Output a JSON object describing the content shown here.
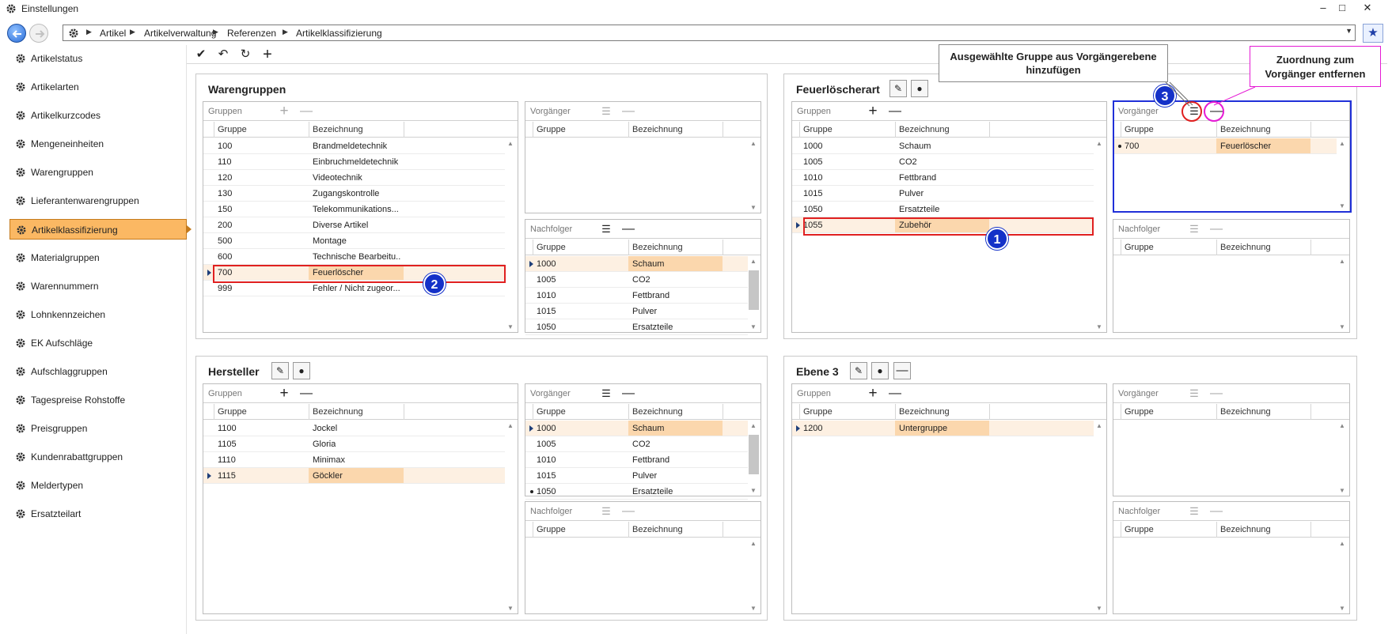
{
  "window": {
    "title": "Einstellungen",
    "minimize": "–",
    "maximize": "□",
    "close": "✕"
  },
  "nav": {
    "crumbs": [
      "Artikel",
      "Artikelverwaltung",
      "Referenzen",
      "Artikelklassifizierung"
    ],
    "star": "★"
  },
  "sidebar": {
    "items": [
      {
        "label": "Artikelstatus"
      },
      {
        "label": "Artikelarten"
      },
      {
        "label": "Artikelkurzcodes"
      },
      {
        "label": "Mengeneinheiten"
      },
      {
        "label": "Warengruppen"
      },
      {
        "label": "Lieferantenwarengruppen"
      },
      {
        "label": "Artikelklassifizierung",
        "active": true
      },
      {
        "label": "Materialgruppen"
      },
      {
        "label": "Warennummern"
      },
      {
        "label": "Lohnkennzeichen"
      },
      {
        "label": "EK Aufschläge"
      },
      {
        "label": "Aufschlaggruppen"
      },
      {
        "label": "Tagespreise Rohstoffe"
      },
      {
        "label": "Preisgruppen"
      },
      {
        "label": "Kundenrabattgruppen"
      },
      {
        "label": "Meldertypen"
      },
      {
        "label": "Ersatzteilart"
      }
    ]
  },
  "toolbar": {
    "save": "✔",
    "undo": "↶",
    "refresh": "↻",
    "add": "+"
  },
  "labels": {
    "gruppen": "Gruppen",
    "vorgaenger": "Vorgänger",
    "nachfolger": "Nachfolger",
    "col_gruppe": "Gruppe",
    "col_bezeichnung": "Bezeichnung"
  },
  "panels": {
    "warengruppen": {
      "title": "Warengruppen",
      "gruppen": [
        [
          "100",
          "Brandmeldetechnik"
        ],
        [
          "110",
          "Einbruchmeldetechnik"
        ],
        [
          "120",
          "Videotechnik"
        ],
        [
          "130",
          "Zugangskontrolle"
        ],
        [
          "150",
          "Telekommunikations..."
        ],
        [
          "200",
          "Diverse Artikel"
        ],
        [
          "500",
          "Montage"
        ],
        [
          "600",
          "Technische Bearbeitu..."
        ],
        [
          "700",
          "Feuerlöscher"
        ],
        [
          "999",
          "Fehler / Nicht zugeor..."
        ]
      ],
      "vorgaenger": [],
      "nachfolger": [
        [
          "1000",
          "Schaum"
        ],
        [
          "1005",
          "CO2"
        ],
        [
          "1010",
          "Fettbrand"
        ],
        [
          "1015",
          "Pulver"
        ],
        [
          "1050",
          "Ersatzteile"
        ]
      ]
    },
    "feuerloescherart": {
      "title": "Feuerlöscherart",
      "gruppen": [
        [
          "1000",
          "Schaum"
        ],
        [
          "1005",
          "CO2"
        ],
        [
          "1010",
          "Fettbrand"
        ],
        [
          "1015",
          "Pulver"
        ],
        [
          "1050",
          "Ersatzteile"
        ],
        [
          "1055",
          "Zubehör"
        ]
      ],
      "vorgaenger": [
        [
          "700",
          "Feuerlöscher"
        ]
      ],
      "nachfolger": []
    },
    "hersteller": {
      "title": "Hersteller",
      "gruppen": [
        [
          "1100",
          "Jockel"
        ],
        [
          "1105",
          "Gloria"
        ],
        [
          "1110",
          "Minimax"
        ],
        [
          "1115",
          "Göckler"
        ]
      ],
      "vorgaenger": [
        [
          "1000",
          "Schaum"
        ],
        [
          "1005",
          "CO2"
        ],
        [
          "1010",
          "Fettbrand"
        ],
        [
          "1015",
          "Pulver"
        ],
        [
          "1050",
          "Ersatzteile"
        ]
      ],
      "nachfolger": []
    },
    "ebene3": {
      "title": "Ebene 3",
      "gruppen": [
        [
          "1200",
          "Untergruppe"
        ]
      ],
      "vorgaenger": [],
      "nachfolger": []
    }
  },
  "annotations": {
    "callout_add": "Ausgewählte Gruppe aus Vorgängerebene hinzufügen",
    "callout_remove": "Zuordnung zum Vorgänger entfernen",
    "badge1": "1",
    "badge2": "2",
    "badge3": "3"
  },
  "colors": {
    "accent": "#fbb863",
    "selection": "#fbd7ad",
    "annotation_red": "#e02020",
    "annotation_blue": "#1431c8",
    "annotation_magenta": "#e51ad4"
  }
}
